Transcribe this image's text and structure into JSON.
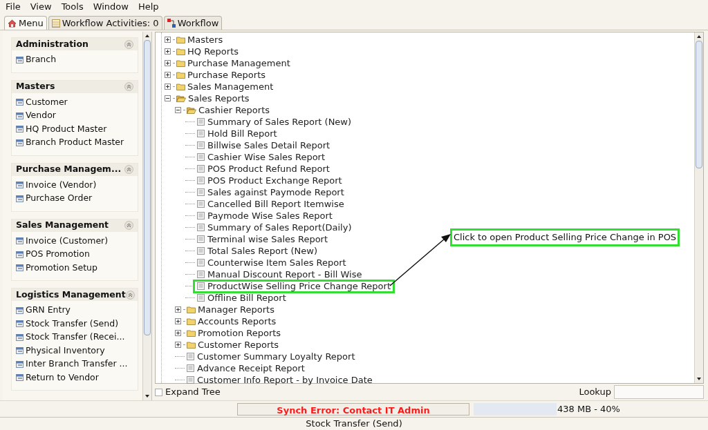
{
  "menu_bar": [
    "File",
    "View",
    "Tools",
    "Window",
    "Help"
  ],
  "tabs": [
    {
      "label": "Menu",
      "selected": true
    },
    {
      "label": "Workflow Activities: 0",
      "selected": false
    },
    {
      "label": "Workflow",
      "selected": false
    }
  ],
  "sidebar": {
    "sections": [
      {
        "title": "Administration",
        "items": [
          "Branch"
        ]
      },
      {
        "title": "Masters",
        "items": [
          "Customer",
          "Vendor",
          "HQ Product Master",
          "Branch Product Master"
        ]
      },
      {
        "title": "Purchase Managem...",
        "items": [
          "Invoice (Vendor)",
          "Purchase Order"
        ]
      },
      {
        "title": "Sales Management",
        "items": [
          "Invoice (Customer)",
          "POS Promotion",
          "Promotion Setup"
        ]
      },
      {
        "title": "Logistics Management",
        "items": [
          "GRN Entry",
          "Stock Transfer (Send)",
          "Stock Transfer (Recei...",
          "Physical Inventory",
          "Inter Branch Transfer ...",
          "Return to Vendor"
        ]
      }
    ]
  },
  "tree": [
    {
      "label": "Masters",
      "kind": "folder",
      "expanded": false
    },
    {
      "label": "HQ Reports",
      "kind": "folder",
      "expanded": false
    },
    {
      "label": "Purchase Management",
      "kind": "folder",
      "expanded": false
    },
    {
      "label": "Purchase Reports",
      "kind": "folder",
      "expanded": false
    },
    {
      "label": "Sales Management",
      "kind": "folder",
      "expanded": false
    },
    {
      "label": "Sales Reports",
      "kind": "folder",
      "expanded": true,
      "children": [
        {
          "label": "Cashier Reports",
          "kind": "folder",
          "expanded": true,
          "children": [
            {
              "label": "Summary of Sales Report (New)",
              "kind": "report",
              "highlighted": false
            },
            {
              "label": "Hold Bill Report",
              "kind": "report",
              "highlighted": false
            },
            {
              "label": "Billwise Sales Detail Report",
              "kind": "report",
              "highlighted": false
            },
            {
              "label": "Cashier Wise Sales Report",
              "kind": "report",
              "highlighted": false
            },
            {
              "label": "POS Product Refund Report",
              "kind": "report",
              "highlighted": false
            },
            {
              "label": "POS Product Exchange Report",
              "kind": "report",
              "highlighted": false
            },
            {
              "label": "Sales against Paymode Report",
              "kind": "report",
              "highlighted": false
            },
            {
              "label": "Cancelled Bill Report Itemwise",
              "kind": "report",
              "highlighted": false
            },
            {
              "label": "Paymode Wise Sales Report",
              "kind": "report",
              "highlighted": false
            },
            {
              "label": "Summary of Sales Report(Daily)",
              "kind": "report",
              "highlighted": false
            },
            {
              "label": "Terminal wise Sales Report",
              "kind": "report",
              "highlighted": false
            },
            {
              "label": "Total Sales Report (New)",
              "kind": "report",
              "highlighted": false
            },
            {
              "label": "Counterwise Item Sales Report",
              "kind": "report",
              "highlighted": false
            },
            {
              "label": "Manual Discount Report - Bill Wise",
              "kind": "report",
              "highlighted": false
            },
            {
              "label": "ProductWise Selling Price Change Report",
              "kind": "report",
              "highlighted": true
            },
            {
              "label": "Offline Bill Report",
              "kind": "report",
              "highlighted": false
            }
          ]
        },
        {
          "label": "Manager Reports",
          "kind": "folder",
          "expanded": false
        },
        {
          "label": "Accounts Reports",
          "kind": "folder",
          "expanded": false
        },
        {
          "label": "Promotion Reports",
          "kind": "folder",
          "expanded": false
        },
        {
          "label": "Customer Reports",
          "kind": "folder",
          "expanded": false
        },
        {
          "label": "Customer Summary Loyalty Report",
          "kind": "report",
          "highlighted": false
        },
        {
          "label": "Advance Receipt Report",
          "kind": "report",
          "highlighted": false
        },
        {
          "label": "Customer Info Report - by Invoice Date",
          "kind": "report",
          "highlighted": false
        }
      ]
    }
  ],
  "callout": "Click to open Product Selling Price Change in POS",
  "expand_tree": {
    "label": "Expand Tree",
    "checked": false
  },
  "lookup": {
    "label": "Lookup"
  },
  "sync_error": "Synch Error: Contact IT Admin",
  "memory": {
    "reading": "438 MB - 40%",
    "level": 0.36
  },
  "status_bar": "Stock Transfer (Send)"
}
